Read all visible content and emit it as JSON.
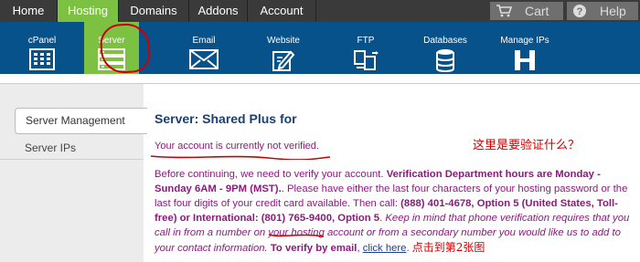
{
  "topnav": {
    "tabs": [
      "Home",
      "Hosting",
      "Domains",
      "Addons",
      "Account"
    ],
    "cart_label": "Cart",
    "help_label": "Help"
  },
  "iconbar": {
    "items": [
      "cPanel",
      "Server",
      "Email",
      "Website",
      "FTP",
      "Databases",
      "Manage IPs"
    ]
  },
  "sidebar": {
    "active_item": "Server Management",
    "items": [
      "Server IPs"
    ]
  },
  "main": {
    "title": "Server: Shared Plus for",
    "warning": "Your account is currently not verified.",
    "annotation_question": "这里是要验证什么？",
    "p_intro": "Before continuing, we need to verify your account. ",
    "p_hours": "Verification Department hours are Monday - Sunday 6AM - 9PM (MST).",
    "p_mid": ". Please have either the last four characters of your hosting password or the last four digits of your credit card available. Then call: ",
    "p_phone": "(888) 401-4678, Option 5 (United States, Toll-free) or International: (801) 765-9400, Option 5",
    "p_dot": ". ",
    "p_italic": "Keep in mind that phone verification requires that you call in from a number on your hosting account or from a secondary number you would like us to add to your contact information.",
    "p_space": " ",
    "p_email": "To verify by email",
    "p_comma": ", ",
    "link": "click here",
    "p_end": ".",
    "annotation_click": "点击到第2张图"
  },
  "colors": {
    "nav_bg": "#3a3a3a",
    "active_green": "#7dc142",
    "iconbar_blue": "#07528b",
    "title_navy": "#1c3f6e",
    "text_purple": "#8b1a7d",
    "annotation_red": "#cc0000"
  },
  "icons": [
    "cart-icon",
    "help-icon",
    "cpanel-icon",
    "server-icon",
    "email-icon",
    "website-icon",
    "ftp-icon",
    "databases-icon",
    "manage-ips-icon"
  ]
}
